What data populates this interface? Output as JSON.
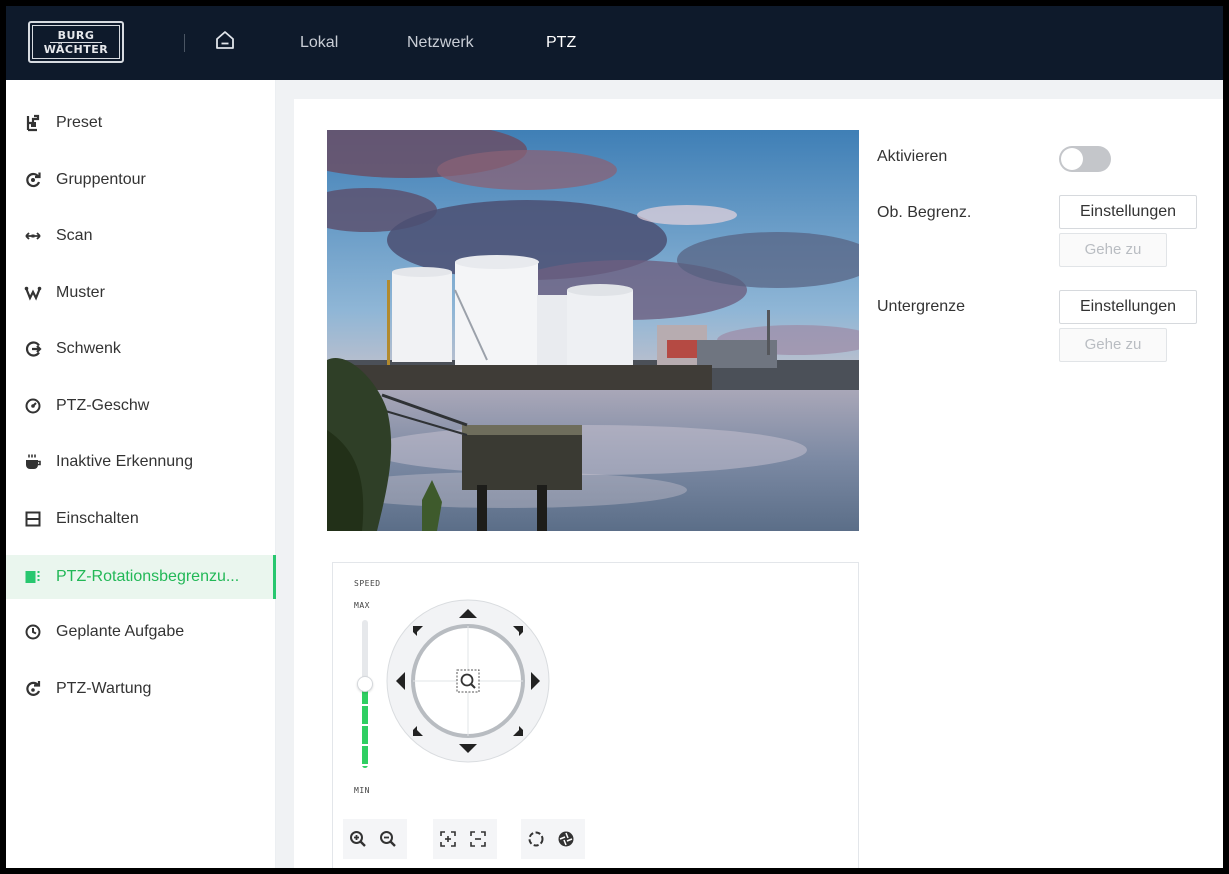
{
  "header": {
    "logo_line1": "BURG",
    "logo_line2": "WÄCHTER",
    "tabs": [
      {
        "label": "Lokal"
      },
      {
        "label": "Netzwerk"
      },
      {
        "label": "PTZ"
      }
    ],
    "active_tab": "PTZ"
  },
  "sidebar": {
    "items": [
      {
        "label": "Preset",
        "icon": "preset-icon"
      },
      {
        "label": "Gruppentour",
        "icon": "tour-icon"
      },
      {
        "label": "Scan",
        "icon": "scan-icon"
      },
      {
        "label": "Muster",
        "icon": "pattern-icon"
      },
      {
        "label": "Schwenk",
        "icon": "pan-icon"
      },
      {
        "label": "PTZ-Geschw",
        "icon": "speed-icon"
      },
      {
        "label": "Inaktive Erkennung",
        "icon": "idle-icon"
      },
      {
        "label": "Einschalten",
        "icon": "power-up-icon"
      },
      {
        "label": "PTZ-Rotationsbegrenzu...",
        "icon": "limit-icon"
      },
      {
        "label": "Geplante Aufgabe",
        "icon": "clock-icon"
      },
      {
        "label": "PTZ-Wartung",
        "icon": "maintenance-icon"
      }
    ],
    "active_index": 8
  },
  "ptz": {
    "speed_label": "SPEED",
    "max_label": "MAX",
    "min_label": "MIN",
    "speed_level": 0.58
  },
  "settings": {
    "enable_label": "Aktivieren",
    "enable_on": false,
    "upper_label": "Ob. Begrenz.",
    "lower_label": "Untergrenze",
    "set_button": "Einstellungen",
    "goto_button": "Gehe zu"
  },
  "colors": {
    "header_bg": "#0e1a2b",
    "accent": "#28c76f",
    "toggle_off": "#c4c6ca"
  }
}
